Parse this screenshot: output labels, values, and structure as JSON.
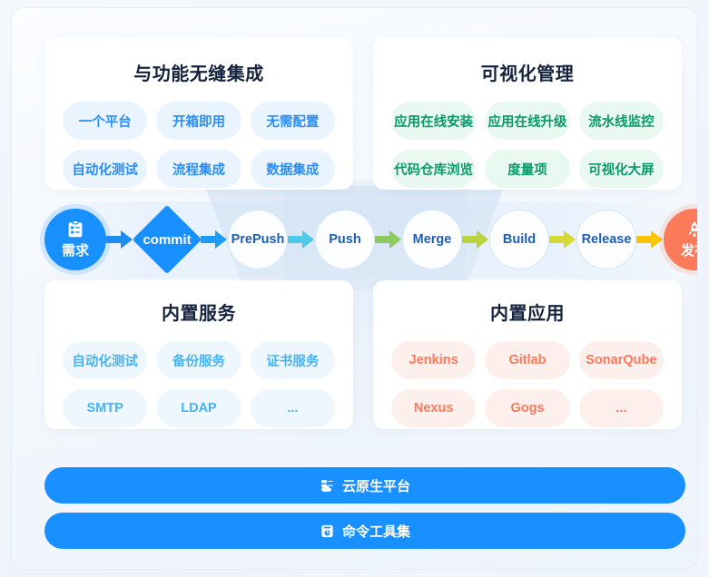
{
  "cards": [
    {
      "id": "integration",
      "title": "与功能无缝集成",
      "pill_style": "blue",
      "pills": [
        "一个平台",
        "开箱即用",
        "无需配置",
        "自动化测试",
        "流程集成",
        "数据集成"
      ]
    },
    {
      "id": "visual",
      "title": "可视化管理",
      "pill_style": "green",
      "pills": [
        "应用在线安装",
        "应用在线升级",
        "流水线监控",
        "代码仓库浏览",
        "度量项",
        "可视化大屏"
      ]
    },
    {
      "id": "services",
      "title": "内置服务",
      "pill_style": "sky",
      "pills": [
        "自动化测试",
        "备份服务",
        "证书服务",
        "SMTP",
        "LDAP",
        "..."
      ]
    },
    {
      "id": "apps",
      "title": "内置应用",
      "pill_style": "coral",
      "pills": [
        "Jenkins",
        "Gitlab",
        "SonarQube",
        "Nexus",
        "Gogs",
        "..."
      ]
    }
  ],
  "pipeline": {
    "start": {
      "label": "需求",
      "icon": "clipboard-checklist-icon",
      "color": "#1890ff"
    },
    "diamond": {
      "label": "commit",
      "color": "#1890ff"
    },
    "stages": [
      "PrePush",
      "Push",
      "Merge",
      "Build",
      "Release"
    ],
    "end": {
      "label": "发布",
      "icon": "rocket-icon",
      "color": "#fa7a5a"
    },
    "arrow_colors": [
      "#1e8cf0",
      "#1e9cf5",
      "#4fc9e8",
      "#8fc95e",
      "#b9d43f",
      "#d6d933",
      "#ffc400"
    ]
  },
  "bars": [
    {
      "id": "platform",
      "label": "云原生平台",
      "icon": "cloud-server-icon",
      "color": "#1890ff"
    },
    {
      "id": "tools",
      "label": "命令工具集",
      "icon": "terminal-gauge-icon",
      "color": "#1890ff"
    }
  ]
}
